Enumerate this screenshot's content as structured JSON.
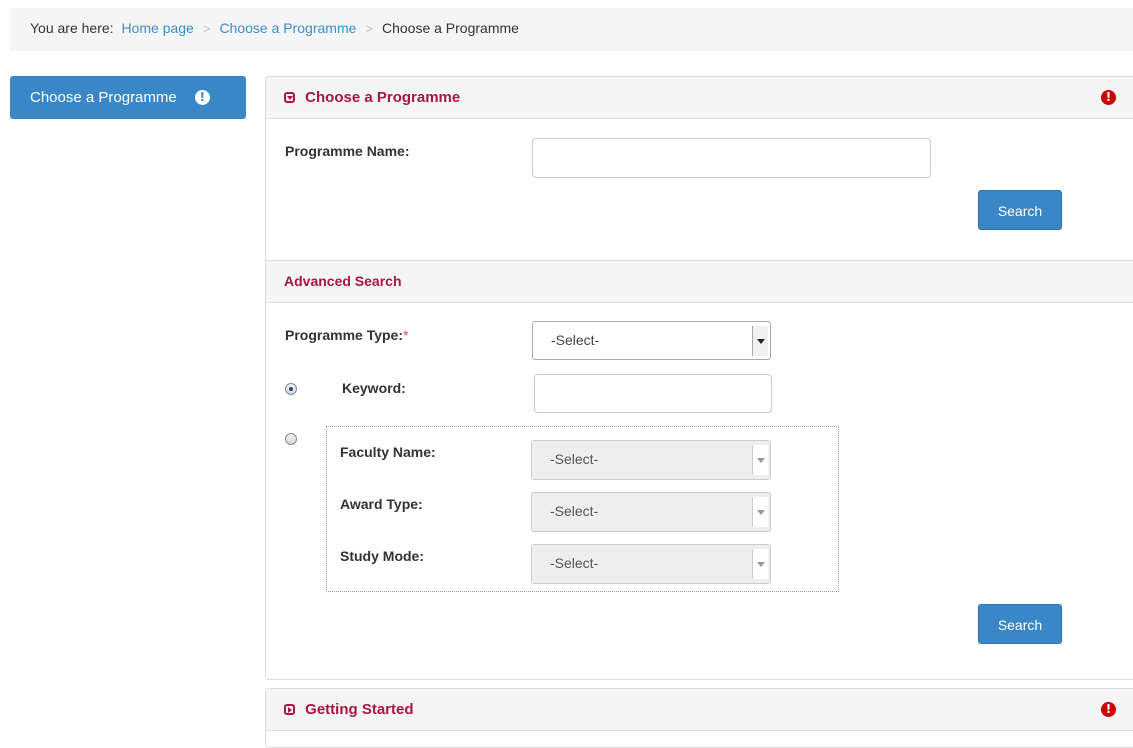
{
  "breadcrumb": {
    "prefix": "You are here:",
    "items": [
      "Home page",
      "Choose a Programme",
      "Choose a Programme"
    ],
    "separator": ">"
  },
  "sidebar": {
    "button_label": "Choose a Programme",
    "icon_glyph": "!"
  },
  "panel": {
    "title": "Choose a Programme",
    "alert_glyph": "!",
    "programme_name_label": "Programme Name:",
    "programme_name_value": "",
    "search_label": "Search"
  },
  "advanced": {
    "title": "Advanced Search",
    "programme_type_label": "Programme Type:",
    "required_mark": "*",
    "programme_type_value": "-Select-",
    "keyword_label": "Keyword:",
    "keyword_value": "",
    "keyword_radio_checked": true,
    "filters_radio_checked": false,
    "faculty_label": "Faculty Name:",
    "faculty_value": "-Select-",
    "award_label": "Award Type:",
    "award_value": "-Select-",
    "study_mode_label": "Study Mode:",
    "study_mode_value": "-Select-",
    "search_label": "Search"
  },
  "getting_started": {
    "title": "Getting Started",
    "alert_glyph": "!"
  },
  "colors": {
    "accent": "#3a87c8",
    "heading": "#a9163f",
    "alert": "#cc0000",
    "link": "#3c8dcb"
  }
}
